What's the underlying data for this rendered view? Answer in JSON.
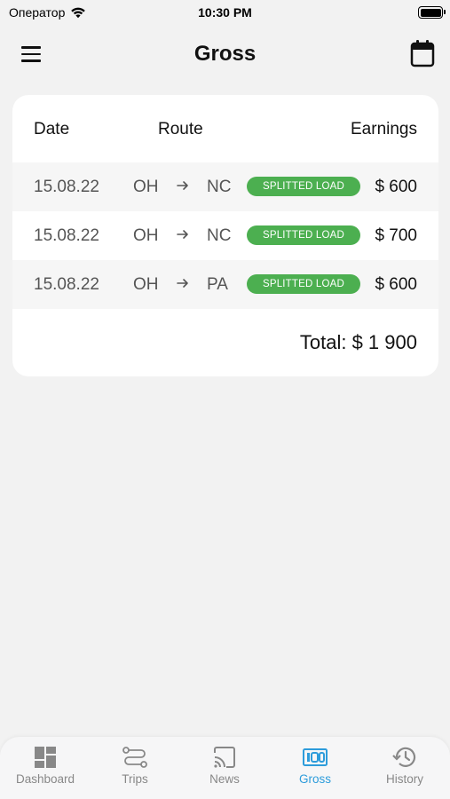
{
  "status_bar": {
    "carrier": "Оператор",
    "time": "10:30 PM"
  },
  "header": {
    "title": "Gross",
    "menu_icon": "hamburger-menu-icon",
    "calendar_icon": "calendar-icon"
  },
  "table": {
    "columns": [
      "Date",
      "Route",
      "Earnings"
    ],
    "rows": [
      {
        "date": "15.08.22",
        "from": "OH",
        "to": "NC",
        "badge": "SPLITTED LOAD",
        "amount": "$ 600"
      },
      {
        "date": "15.08.22",
        "from": "OH",
        "to": "NC",
        "badge": "SPLITTED LOAD",
        "amount": "$ 700"
      },
      {
        "date": "15.08.22",
        "from": "OH",
        "to": "PA",
        "badge": "SPLITTED LOAD",
        "amount": "$ 600"
      }
    ],
    "total": "Total: $ 1 900"
  },
  "tab_bar": {
    "active": "Gross",
    "items": [
      {
        "label": "Dashboard",
        "icon": "dashboard-icon"
      },
      {
        "label": "Trips",
        "icon": "route-icon"
      },
      {
        "label": "News",
        "icon": "cast-icon"
      },
      {
        "label": "Gross",
        "icon": "counter-icon"
      },
      {
        "label": "History",
        "icon": "history-icon"
      }
    ]
  },
  "colors": {
    "background": "#f2f2f2",
    "badge": "#4caf50",
    "active_tab": "#2d9cdb",
    "inactive_tab": "#888888"
  }
}
